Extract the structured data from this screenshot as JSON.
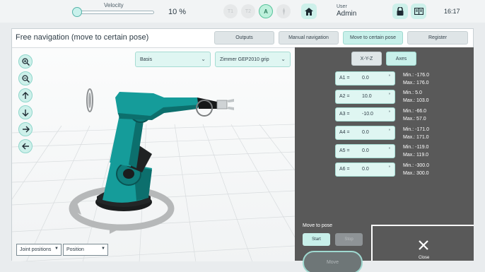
{
  "topbar": {
    "velocity_label": "Velocity",
    "velocity_value": "10 %",
    "velocity_fraction": 0.0,
    "mode_buttons": [
      "T1",
      "T2",
      "A",
      "Ext"
    ],
    "active_mode": "A",
    "home_icon": "home-icon",
    "user_label": "User",
    "user_name": "Admin",
    "lock_icon": "lock-icon",
    "manual_icon": "book-icon",
    "time": "16:17"
  },
  "panel": {
    "title": "Free navigation (move to certain pose)",
    "tabs": [
      {
        "label": "Outputs",
        "active": false
      },
      {
        "label": "Manual navigation",
        "active": false
      },
      {
        "label": "Move to certain pose",
        "active": true
      },
      {
        "label": "Register",
        "active": false
      }
    ]
  },
  "viewport": {
    "frame_select": "Basis",
    "tool_select": "Zimmer GEP2010 grip",
    "nav_icons": [
      "zoom-in-icon",
      "zoom-out-icon",
      "arrow-up-icon",
      "arrow-down-icon",
      "arrow-right-icon",
      "arrow-left-icon"
    ],
    "joint_select": "Joint positions",
    "position_select": "Position"
  },
  "controls": {
    "modes": [
      {
        "label": "X-Y-Z",
        "active": false
      },
      {
        "label": "Axes",
        "active": true
      }
    ],
    "unit": "°",
    "joints": [
      {
        "label": "A1 =",
        "value": "0.0",
        "min": "Min.: -176.0",
        "max": "Max.: 176.0"
      },
      {
        "label": "A2 =",
        "value": "10.0",
        "min": "Min.: 5.0",
        "max": "Max.: 103.0"
      },
      {
        "label": "A3 =",
        "value": "-10.0",
        "min": "Min.: -66.0",
        "max": "Max.: 57.0"
      },
      {
        "label": "A4 =",
        "value": "0.0",
        "min": "Min.: -171.0",
        "max": "Max.: 171.0"
      },
      {
        "label": "A5 =",
        "value": "0.0",
        "min": "Min.: -119.0",
        "max": "Max.: 119.0"
      },
      {
        "label": "A6 =",
        "value": "0.0",
        "min": "Min.: -300.0",
        "max": "Max.: 300.0"
      }
    ],
    "move_to_pose_label": "Move to pose",
    "start_label": "Start",
    "stop_label": "Stop",
    "move_label": "Move"
  },
  "close": {
    "label": "Close",
    "icon": "close-icon"
  },
  "colors": {
    "accent": "#c8f0ea",
    "accent_border": "#9fd9d0",
    "robot": "#159c9a",
    "panel_dark": "#595959"
  }
}
